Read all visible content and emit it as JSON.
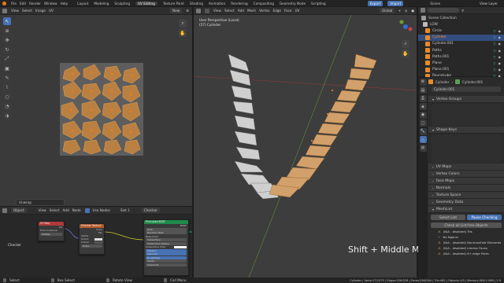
{
  "app": {
    "menu": [
      "File",
      "Edit",
      "Render",
      "Window",
      "Help"
    ],
    "workspaces": [
      "Layout",
      "Modeling",
      "Sculpting",
      "UV Editing",
      "Texture Paint",
      "Shading",
      "Animation",
      "Rendering",
      "Compositing",
      "Geometry Node",
      "Scripting"
    ],
    "active_workspace": "UV Editing",
    "export_label": "Export",
    "import_label": "Import",
    "scene_label": "Scene",
    "view_layer_label": "View Layer"
  },
  "uv_editor": {
    "header_items": [
      "View",
      "Select",
      "Image",
      "UV"
    ],
    "new_label": "New",
    "undo_panel": "Unwrap"
  },
  "viewport": {
    "header_items": [
      "View",
      "Select",
      "Add",
      "Mesh",
      "Vertex",
      "Edge",
      "Face",
      "UV"
    ],
    "transform": "Global",
    "title": "User Perspective (Local)",
    "subtitle": "(57) Cylinder",
    "overlay_text": "Shift + Middle Mo"
  },
  "node_editor": {
    "editor_type": "Object",
    "header_items": [
      "View",
      "Select",
      "Add",
      "Node"
    ],
    "use_nodes_label": "Use Nodes",
    "slot": "Slot 1",
    "material": "Checker",
    "footer_label": "Checker",
    "nodes": [
      {
        "title": "UV Map",
        "color": "#b03a3a",
        "rows": [
          "UV",
          "From Instancer",
          "UVMap"
        ]
      },
      {
        "title": "Checker Texture",
        "color": "#b35a2d",
        "rows": [
          "Color",
          "Fac",
          "Vector",
          "Color1",
          "Color2",
          "Scale"
        ]
      },
      {
        "title": "Principled BSDF",
        "color": "#1f8a4a",
        "rows": [
          "BSDF",
          "GGX",
          "Random Walk",
          "Base Color",
          "Subsurface",
          "Subsurface Radius",
          "Subsurface Color",
          "Metallic",
          "Specular",
          "Roughness",
          "Sheen",
          "Clearcoat"
        ]
      }
    ]
  },
  "outliner": {
    "root": "Scene Collection",
    "collection": "LOW",
    "items": [
      "Circle",
      "Cylinder",
      "Cylinder.001",
      "Paths",
      "Paths.001",
      "Plane",
      "Plane.001",
      "Roundcube"
    ]
  },
  "properties": {
    "object_name": "Cylinder",
    "data_name": "Cylinder.001",
    "mesh_field": "Cylinder.001",
    "sections": [
      "Vertex Groups",
      "Shape Keys",
      "UV Maps",
      "Vertex Colors",
      "Face Maps",
      "Normals",
      "Texture Space",
      "Geometry Data",
      "MeshLint"
    ],
    "meshlint": {
      "select_button": "Select Lint",
      "continuous_button": "Pause Checking",
      "check_all": "Check all Lint-free Objects",
      "warnings": [
        "(N/A - disabled) Tris",
        "No Ngons!",
        "(N/A - disabled) Nonmanifold Elements",
        "(N/A - disabled) Interior Faces",
        "(N/A - disabled) 6+-edge Poles"
      ]
    }
  },
  "status_bar": {
    "left_items": [
      "Select",
      "Box Select",
      "Rotate View",
      "Call Menu"
    ],
    "stats": "Cylinder | Verts:272/375 | Edges:528/528 | Faces:264/264 | Tris:462 | Objects:1/9 | Memory:308.2 MiB | 2.9"
  },
  "colors": {
    "accent": "#4772b3",
    "orange": "#e88a2a",
    "selected_item": "#ff8c2a"
  }
}
